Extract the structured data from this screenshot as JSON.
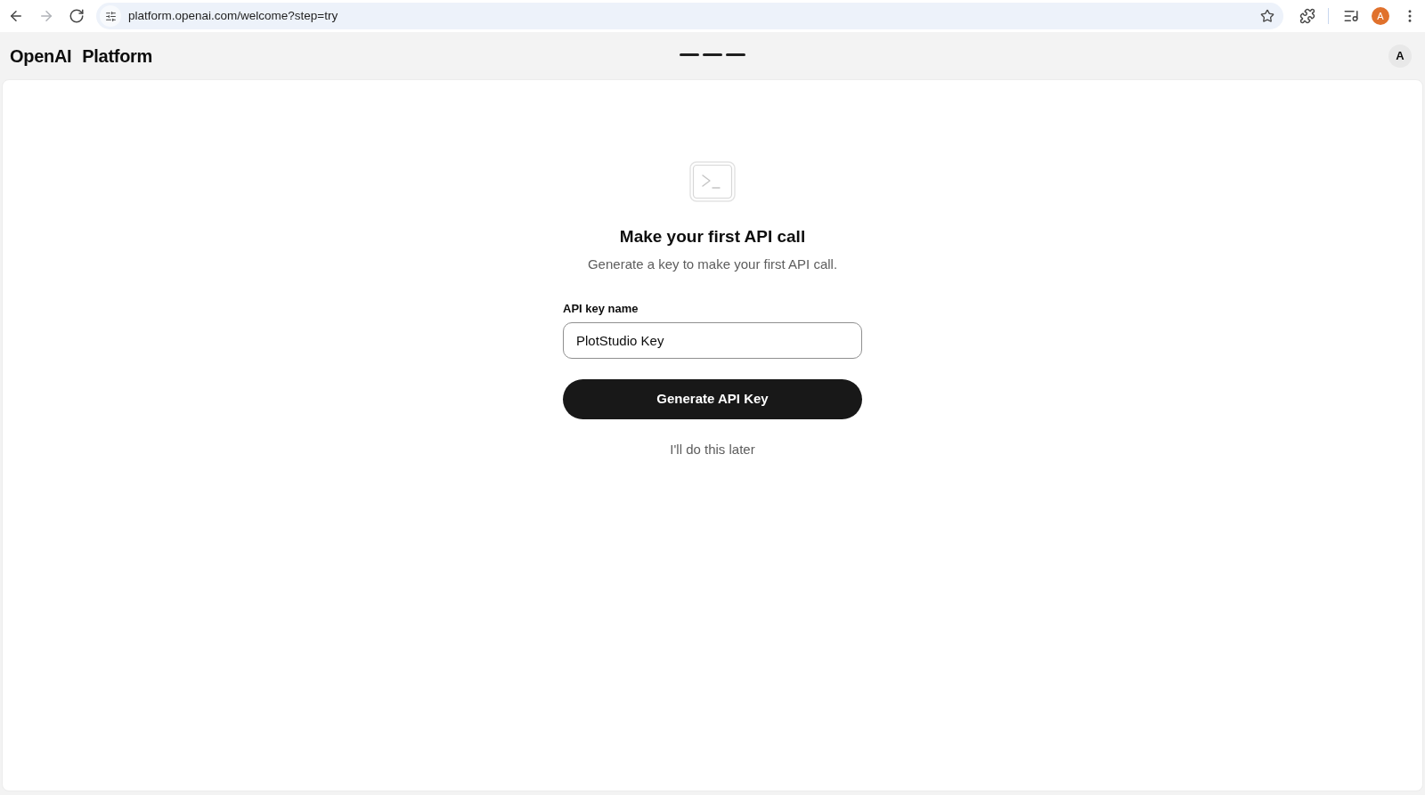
{
  "browser": {
    "nav": [
      {
        "kind": "back",
        "disabled": false
      },
      {
        "kind": "forward",
        "disabled": true
      },
      {
        "kind": "reload",
        "disabled": false
      }
    ],
    "url": "platform.openai.com/welcome?step=try",
    "profile_initial": "A"
  },
  "header": {
    "logo": "OpenAI",
    "product": "Platform",
    "steps": [
      {
        "done": true
      },
      {
        "done": true
      },
      {
        "done": true
      }
    ],
    "avatar_initial": "A"
  },
  "onboarding": {
    "title": "Make your first API call",
    "subtitle": "Generate a key to make your first API call.",
    "field": {
      "label": "API key name",
      "value": "PlotStudio Key",
      "focused": true
    },
    "primary_button": "Generate API Key",
    "secondary_link": "I'll do this later"
  }
}
